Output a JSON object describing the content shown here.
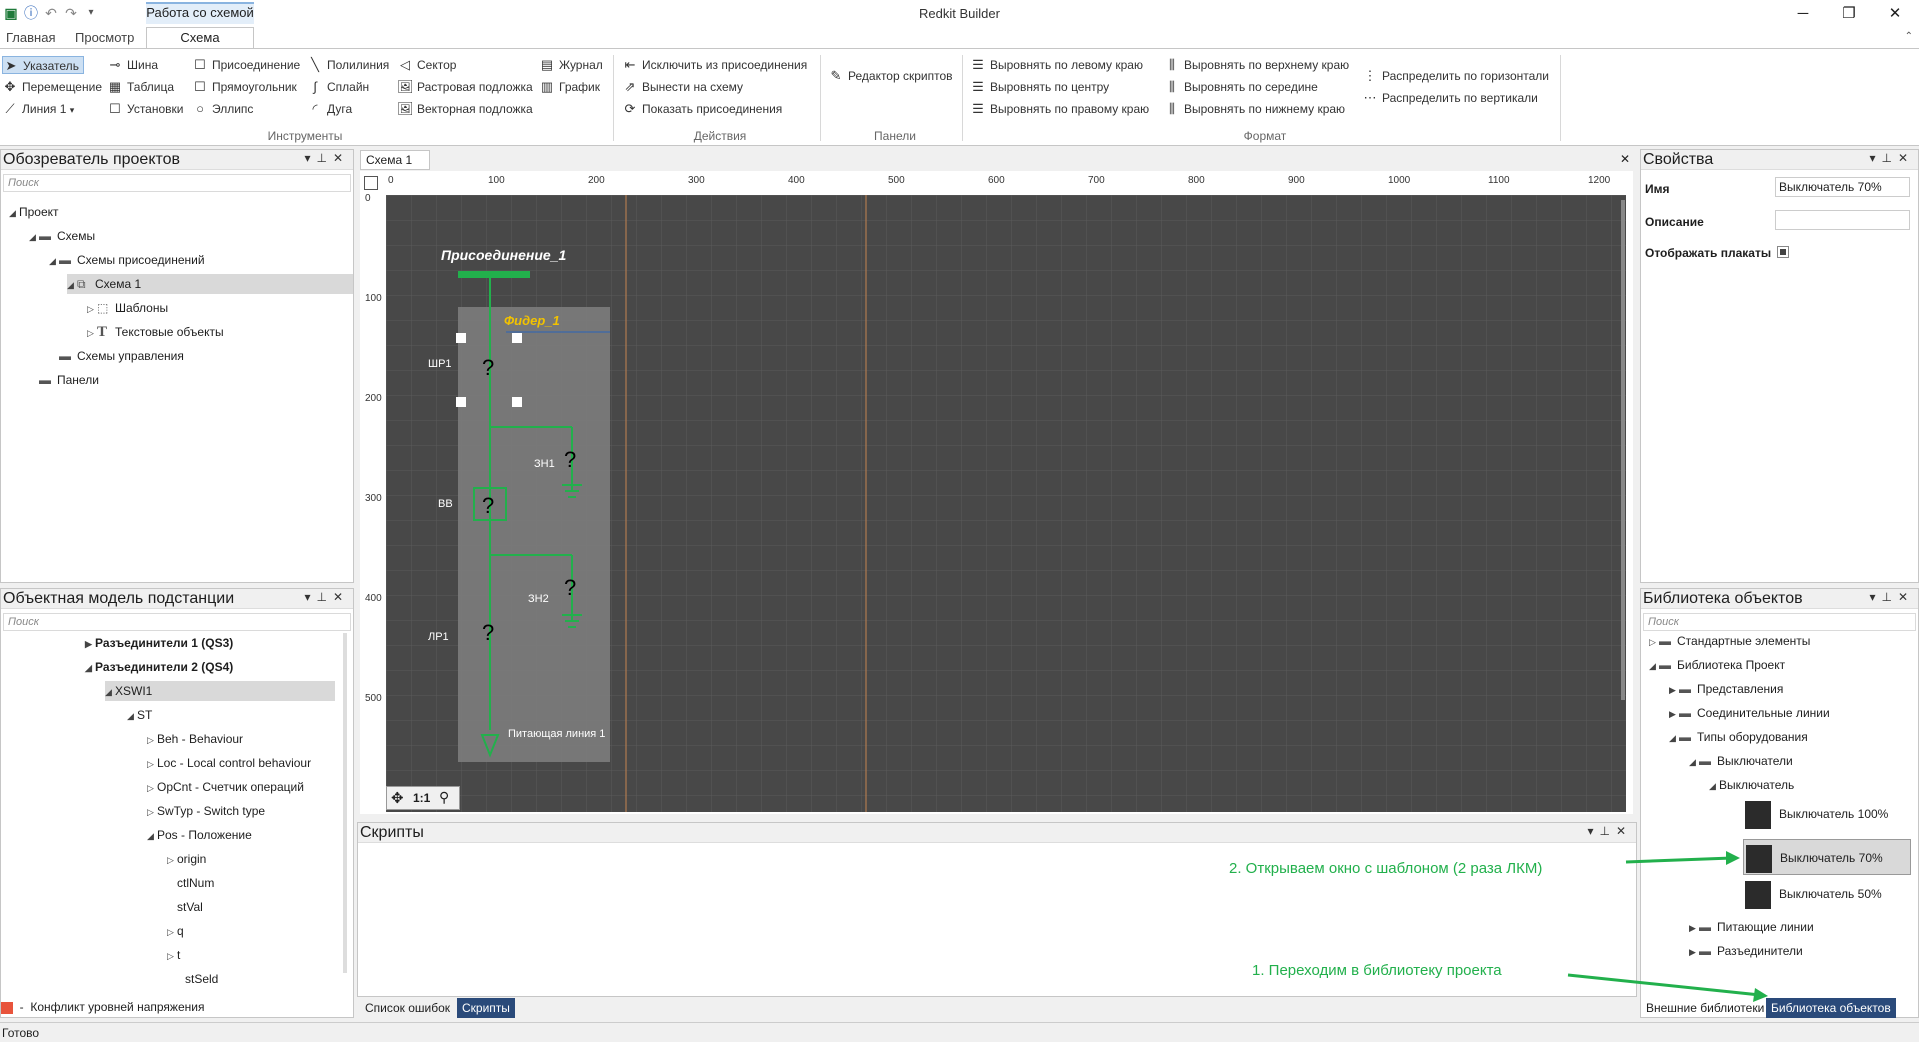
{
  "window": {
    "app_title": "Redkit Builder",
    "context_tab": "Работа со схемой",
    "min": "─",
    "max": "❐",
    "close": "✕"
  },
  "ribbon_tabs": [
    "Главная",
    "Просмотр",
    "Схема"
  ],
  "ribbon": {
    "tools": {
      "label": "Инструменты",
      "pointer": "Указатель",
      "move": "Перемещение",
      "line": "Линия 1",
      "bus": "Шина",
      "table": "Таблица",
      "settings": "Установки",
      "connection": "Присоединение",
      "rectangle": "Прямоугольник",
      "ellipse": "Эллипс",
      "polyline": "Полилиния",
      "spline": "Сплайн",
      "arc": "Дуга",
      "sector": "Сектор",
      "raster": "Растровая подложка",
      "vector": "Векторная подложка",
      "journal": "Журнал",
      "graph": "График"
    },
    "actions": {
      "label": "Действия",
      "exclude": "Исключить из присоединения",
      "bring_out": "Вынести на схему",
      "show": "Показать присоединения"
    },
    "panels": {
      "label": "Панели",
      "script_editor": "Редактор скриптов"
    },
    "format": {
      "label": "Формат",
      "align_left": "Выровнять по левому краю",
      "align_center": "Выровнять по центру",
      "align_right": "Выровнять по правому краю",
      "align_top": "Выровнять по верхнему краю",
      "align_middle": "Выровнять по середине",
      "align_bottom": "Выровнять по нижнему краю",
      "distribute_h": "Распределить по горизонтали",
      "distribute_v": "Распределить по вертикали"
    }
  },
  "project_explorer": {
    "title": "Обозреватель проектов",
    "search_placeholder": "Поиск",
    "items": [
      "Проект",
      "Схемы",
      "Схемы присоединений",
      "Схема 1",
      "Шаблоны",
      "Текстовые объекты",
      "Схемы управления",
      "Панели"
    ]
  },
  "object_model": {
    "title": "Объектная модель подстанции",
    "search_placeholder": "Поиск",
    "items": [
      "Разъединители 1 (QS3)",
      "Разъединители 2 (QS4)",
      "XSWI1",
      "ST",
      "Beh - Behaviour",
      "Loc - Local control behaviour",
      "OpCnt - Счетчик операций",
      "SwTyp - Switch type",
      "Pos - Положение",
      "origin",
      "ctlNum",
      "stVal",
      "q",
      "t",
      "stSeld"
    ],
    "conflict": "Конфликт уровней напряжения"
  },
  "document": {
    "tab": "Схема 1",
    "ruler_top": [
      "0",
      "100",
      "200",
      "300",
      "400",
      "500",
      "600",
      "700",
      "800",
      "900",
      "1000",
      "1100",
      "1200"
    ],
    "ruler_left": [
      "0",
      "100",
      "200",
      "300",
      "400",
      "500"
    ],
    "scheme": {
      "connection_title": "Присоединение_1",
      "feeder": "Фидер_1",
      "labels": [
        "ШР1",
        "ЗН1",
        "ВВ",
        "ЗН2",
        "ЛР1",
        "Питающая линия 1"
      ],
      "unknown": "?"
    },
    "zoom_label": "1:1"
  },
  "properties": {
    "title": "Свойства",
    "name_label": "Имя",
    "name_value": "Выключатель 70%",
    "desc_label": "Описание",
    "desc_value": "",
    "posters_label": "Отображать плакаты"
  },
  "library": {
    "title": "Библиотека объектов",
    "search_placeholder": "Поиск",
    "items": [
      "Стандартные элементы",
      "Библиотека Проект",
      "Представления",
      "Соединительные линии",
      "Типы оборудования",
      "Выключатели",
      "Выключатель",
      "Выключатель 100%",
      "Выключатель 70%",
      "Выключатель 50%",
      "Питающие линии",
      "Разъединители"
    ]
  },
  "scripts": {
    "title": "Скрипты"
  },
  "bottom_tabs": {
    "errors": "Список ошибок",
    "scripts": "Скрипты",
    "external_libs": "Внешние библиотеки",
    "object_lib": "Библиотека объектов"
  },
  "annotations": {
    "step1": "1. Переходим в библиотеку проекта",
    "step2": "2. Открываем окно с шаблоном (2 раза ЛКМ)"
  },
  "status": "Готово",
  "colors": {
    "canvas": "#484848",
    "scheme_line": "#22b04c",
    "feeder_label": "#f2c200",
    "annotation": "#22b04c",
    "active_tab": "#2a4a7a"
  }
}
